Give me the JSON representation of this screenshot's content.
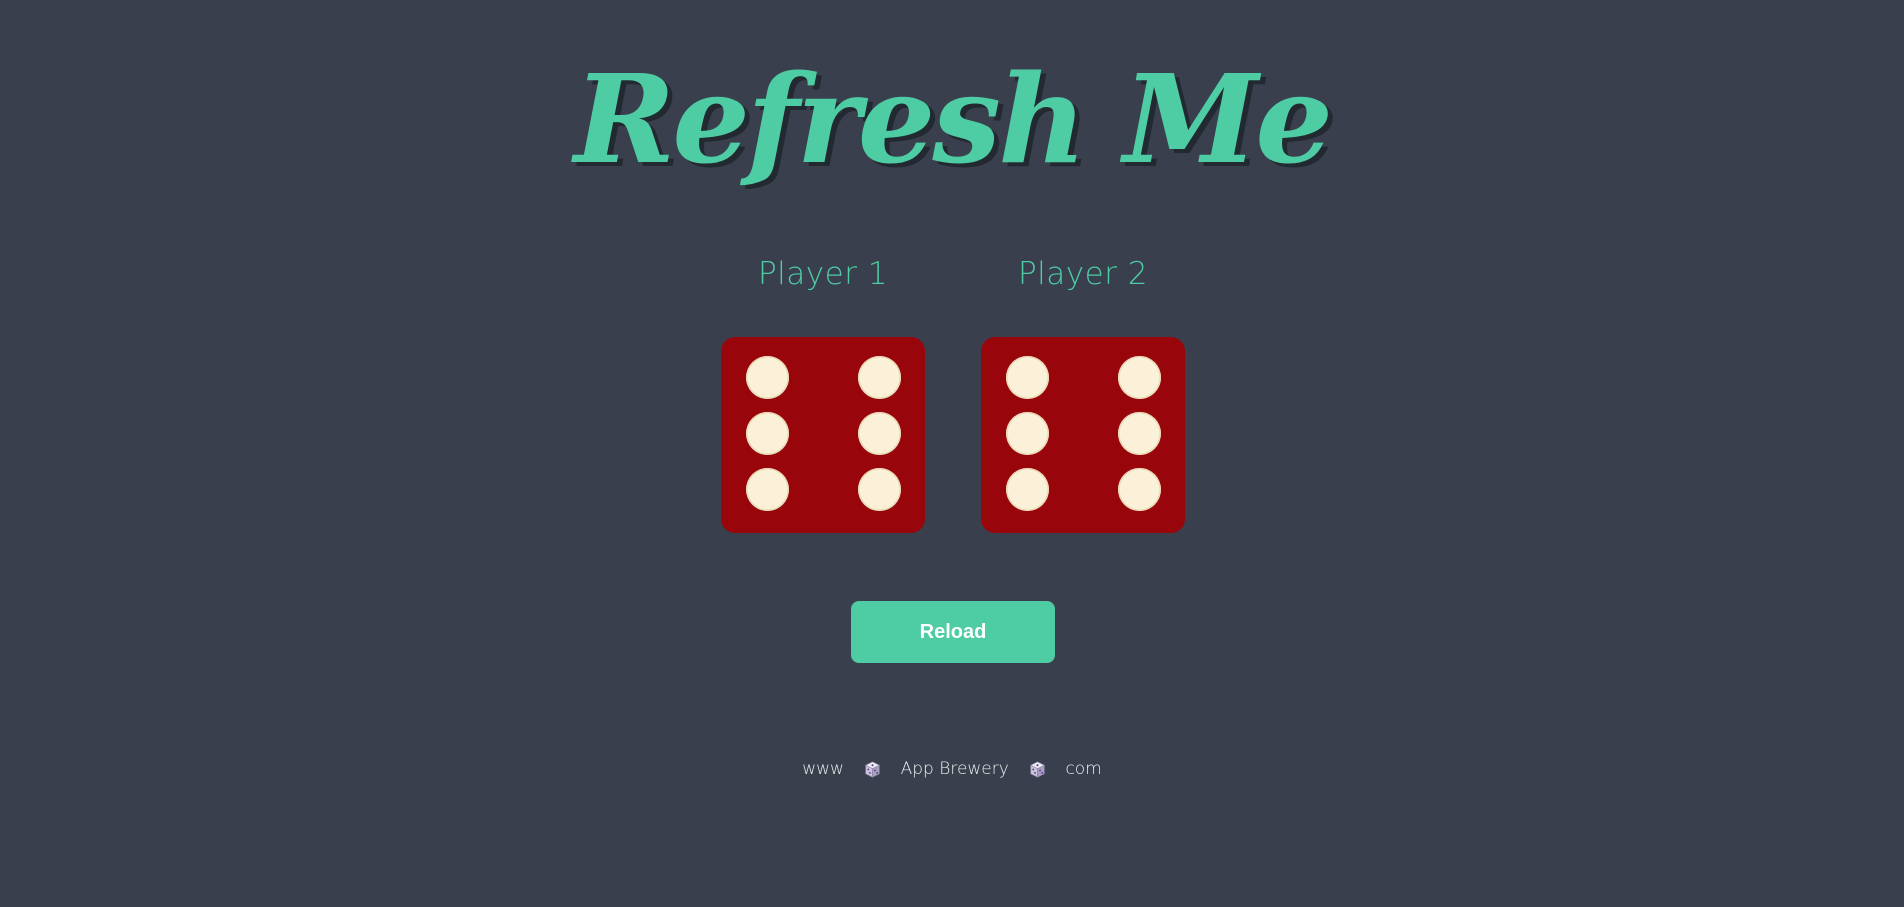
{
  "title": "Refresh Me",
  "players": [
    {
      "label": "Player 1",
      "die_value": 6
    },
    {
      "label": "Player 2",
      "die_value": 6
    }
  ],
  "reload_button": {
    "label": "Reload"
  },
  "footer": {
    "part1": "www",
    "part2": "App Brewery",
    "part3": "com",
    "separator_icon": "game-die-icon"
  },
  "colors": {
    "background": "#393f4d",
    "accent": "#4ecca3",
    "die_face": "#98060b",
    "pip": "#fbf0d8"
  }
}
